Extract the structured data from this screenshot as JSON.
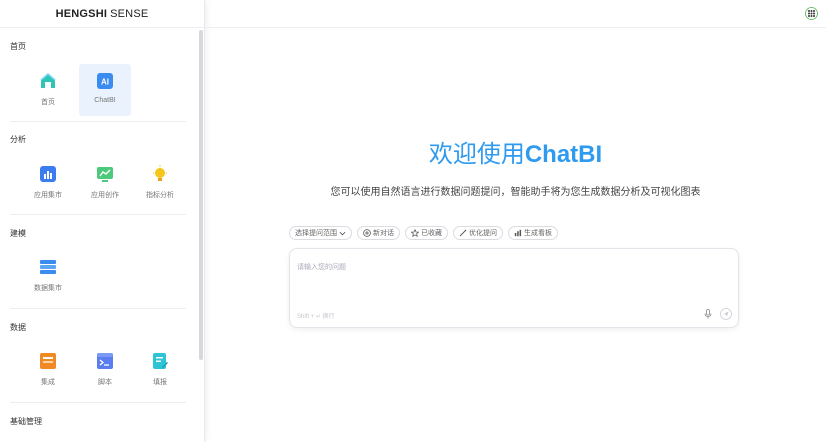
{
  "brand": {
    "bold": "HENGSHI",
    "rest": "SENSE"
  },
  "sections": [
    {
      "title": "首页",
      "items": [
        {
          "label": "首页"
        },
        {
          "label": "ChatBI"
        }
      ]
    },
    {
      "title": "分析",
      "items": [
        {
          "label": "应用集市"
        },
        {
          "label": "应用创作"
        },
        {
          "label": "指标分析"
        }
      ]
    },
    {
      "title": "建模",
      "items": [
        {
          "label": "数据集市"
        }
      ]
    },
    {
      "title": "数据",
      "items": [
        {
          "label": "集成"
        },
        {
          "label": "脚本"
        },
        {
          "label": "填报"
        }
      ]
    },
    {
      "title": "基础管理"
    }
  ],
  "main": {
    "welcome_prefix": "欢迎使用",
    "welcome_brand": "ChatBI",
    "subtitle": "您可以使用自然语言进行数据问题提问，智能助手将为您生成数据分析及可视化图表",
    "chips": {
      "scope": "选择提问范围",
      "new_chat": "新对话",
      "favorites": "已收藏",
      "optimize": "优化提问",
      "dashboard": "生成看板"
    },
    "input": {
      "placeholder": "请输入您的问题",
      "hint": "Shift + ↵ 换行"
    }
  },
  "colors": {
    "accent": "#2e9bf0",
    "active_bg": "#eaf2fd"
  }
}
